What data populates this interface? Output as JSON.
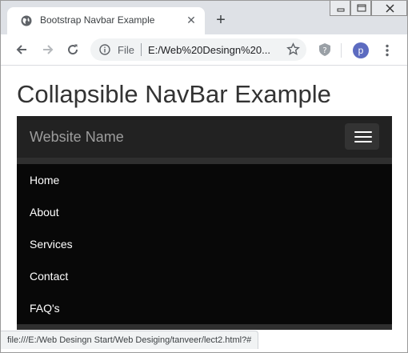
{
  "browser": {
    "tab": {
      "title": "Bootstrap Navbar Example"
    },
    "address": {
      "scheme_label": "File",
      "url": "E:/Web%20Desingn%20..."
    },
    "profile_initial": "p",
    "status_text": "file:///E:/Web Desingn Start/Web Desiging/tanveer/lect2.html?#"
  },
  "page": {
    "title": "Collapsible NavBar Example",
    "navbar": {
      "brand": "Website Name",
      "items": [
        {
          "label": "Home"
        },
        {
          "label": "About"
        },
        {
          "label": "Services"
        },
        {
          "label": "Contact"
        },
        {
          "label": "FAQ's"
        }
      ]
    }
  },
  "colors": {
    "navbar_bg": "#222222",
    "menu_bg": "#080808",
    "brand_text": "#9d9d9d",
    "avatar": "#5c6bc0"
  }
}
